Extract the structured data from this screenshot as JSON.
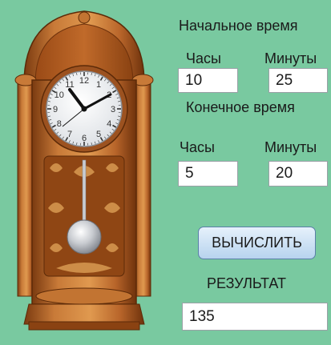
{
  "start": {
    "title": "Начальное время",
    "hours_label": "Часы",
    "minutes_label": "Минуты",
    "hours_value": "10",
    "minutes_value": "25"
  },
  "end": {
    "title": "Конечное время",
    "hours_label": "Часы",
    "minutes_label": "Минуты",
    "hours_value": "5",
    "minutes_value": "20"
  },
  "compute_button": "ВЫЧИСЛИТЬ",
  "result": {
    "label": "РЕЗУЛЬТАТ",
    "value": "135"
  },
  "clock_face": {
    "numerals": [
      "12",
      "1",
      "2",
      "3",
      "4",
      "5",
      "6",
      "7",
      "8",
      "9",
      "10",
      "11"
    ],
    "time_shown": "10:10"
  },
  "colors": {
    "background": "#79c9a0",
    "wood": "#b8652a",
    "wood_dark": "#7a3a10",
    "button": "#c9dff3"
  }
}
